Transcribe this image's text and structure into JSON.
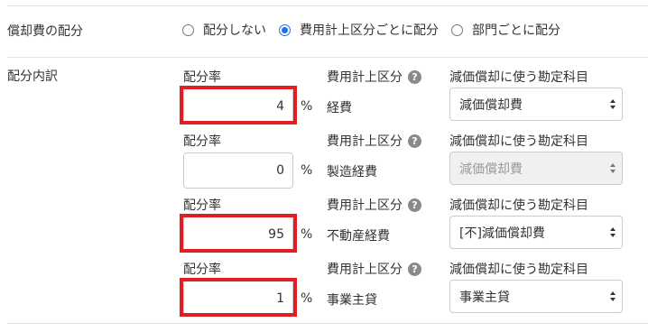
{
  "depreciation": {
    "label": "償却費の配分",
    "options": [
      {
        "label": "配分しない",
        "checked": false
      },
      {
        "label": "費用計上区分ごとに配分",
        "checked": true
      },
      {
        "label": "部門ごとに配分",
        "checked": false
      }
    ]
  },
  "breakdown": {
    "label": "配分内訳",
    "rate_label": "配分率",
    "percent_sign": "%",
    "category_label": "費用計上区分",
    "help_glyph": "?",
    "account_label": "減価償却に使う勘定科目",
    "rows": [
      {
        "rate": "4",
        "category": "経費",
        "account": "減価償却費",
        "account_disabled": false,
        "highlighted": true
      },
      {
        "rate": "0",
        "category": "製造経費",
        "account": "減価償却費",
        "account_disabled": true,
        "highlighted": false
      },
      {
        "rate": "95",
        "category": "不動産経費",
        "account": "[不]減価償却費",
        "account_disabled": false,
        "highlighted": true
      },
      {
        "rate": "1",
        "category": "事業主貸",
        "account": "事業主貸",
        "account_disabled": false,
        "highlighted": true
      }
    ]
  },
  "colors": {
    "highlight": "#e01e24",
    "radio_accent": "#1a73e8"
  }
}
